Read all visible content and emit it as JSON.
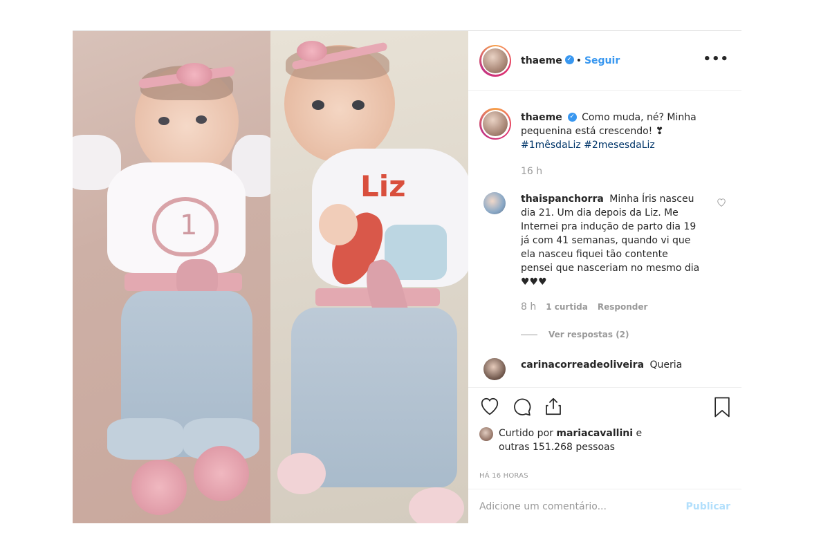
{
  "post": {
    "author": {
      "username": "thaeme",
      "verified_icon": "verified-badge-icon",
      "separator": "•",
      "follow_label": "Seguir"
    },
    "more_label": "•••",
    "photo": {
      "left_onesie_number": "1",
      "right_onesie_text": "Liz"
    }
  },
  "caption": {
    "username": "thaeme",
    "text": "Como muda, né? Minha pequenina está crescendo! ❣",
    "hashtags": "#1mêsdaLiz #2mesesdaLiz",
    "time": "16 h"
  },
  "comments": [
    {
      "username": "thaispanchorra",
      "text": "Minha Íris nasceu dia 21. Um dia depois da Liz. Me Internei pra indução de parto dia 19 já com 41 semanas, quando vi que ela nasceu fiquei tão contente pensei que nasceriam no mesmo dia ♥♥♥",
      "time": "8 h",
      "likes": "1 curtida",
      "reply_label": "Responder",
      "view_replies": "Ver respostas (2)"
    },
    {
      "username": "carinacorreadeoliveira",
      "text": "Queria"
    }
  ],
  "actions": {
    "liked_prefix": "Curtido por",
    "liked_user": "mariacavallini",
    "liked_suffix": "e",
    "liked_others": "outras 151.268 pessoas",
    "timeago": "HÁ 16 HORAS"
  },
  "comment_box": {
    "placeholder": "Adicione um comentário...",
    "publish_label": "Publicar"
  },
  "colors": {
    "accent": "#3897f0",
    "publish_disabled": "#b2dffc",
    "muted": "#999999"
  }
}
